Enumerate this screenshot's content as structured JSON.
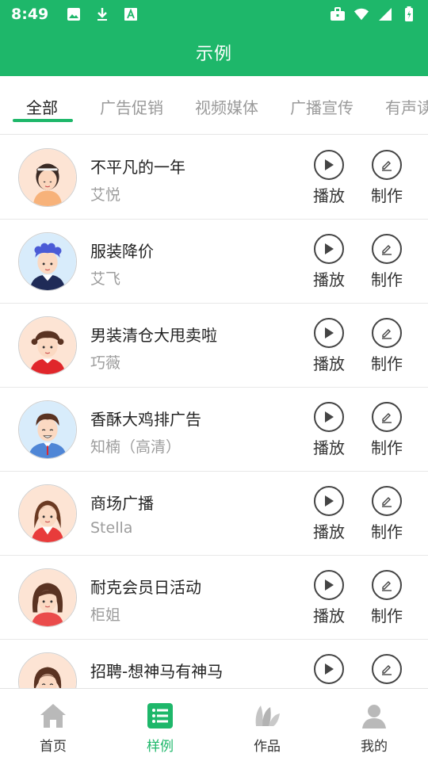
{
  "status_bar": {
    "time": "8:49",
    "left_icons": [
      "image-icon",
      "download-icon",
      "font-icon"
    ],
    "right_icons": [
      "briefcase-icon",
      "wifi-icon",
      "signal-icon",
      "battery-icon"
    ]
  },
  "app_bar": {
    "title": "示例"
  },
  "tabs": [
    {
      "label": "全部",
      "active": true
    },
    {
      "label": "广告促销",
      "active": false
    },
    {
      "label": "视频媒体",
      "active": false
    },
    {
      "label": "广播宣传",
      "active": false
    },
    {
      "label": "有声读",
      "active": false
    }
  ],
  "actions": {
    "play_label": "播放",
    "make_label": "制作"
  },
  "items": [
    {
      "title": "不平凡的一年",
      "voice": "艾悦"
    },
    {
      "title": "服装降价",
      "voice": "艾飞"
    },
    {
      "title": "男装清仓大甩卖啦",
      "voice": "巧薇"
    },
    {
      "title": "香酥大鸡排广告",
      "voice": "知楠（高清）"
    },
    {
      "title": "商场广播",
      "voice": "Stella"
    },
    {
      "title": "耐克会员日活动",
      "voice": "柜姐"
    },
    {
      "title": "招聘-想神马有神马",
      "voice": ""
    }
  ],
  "bottom_nav": [
    {
      "label": "首页",
      "icon": "home-icon",
      "active": false
    },
    {
      "label": "样例",
      "icon": "list-icon",
      "active": true
    },
    {
      "label": "作品",
      "icon": "works-icon",
      "active": false
    },
    {
      "label": "我的",
      "icon": "profile-icon",
      "active": false
    }
  ],
  "colors": {
    "brand": "#1eb76a",
    "text": "#222222",
    "subtext": "#9d9d9d"
  }
}
